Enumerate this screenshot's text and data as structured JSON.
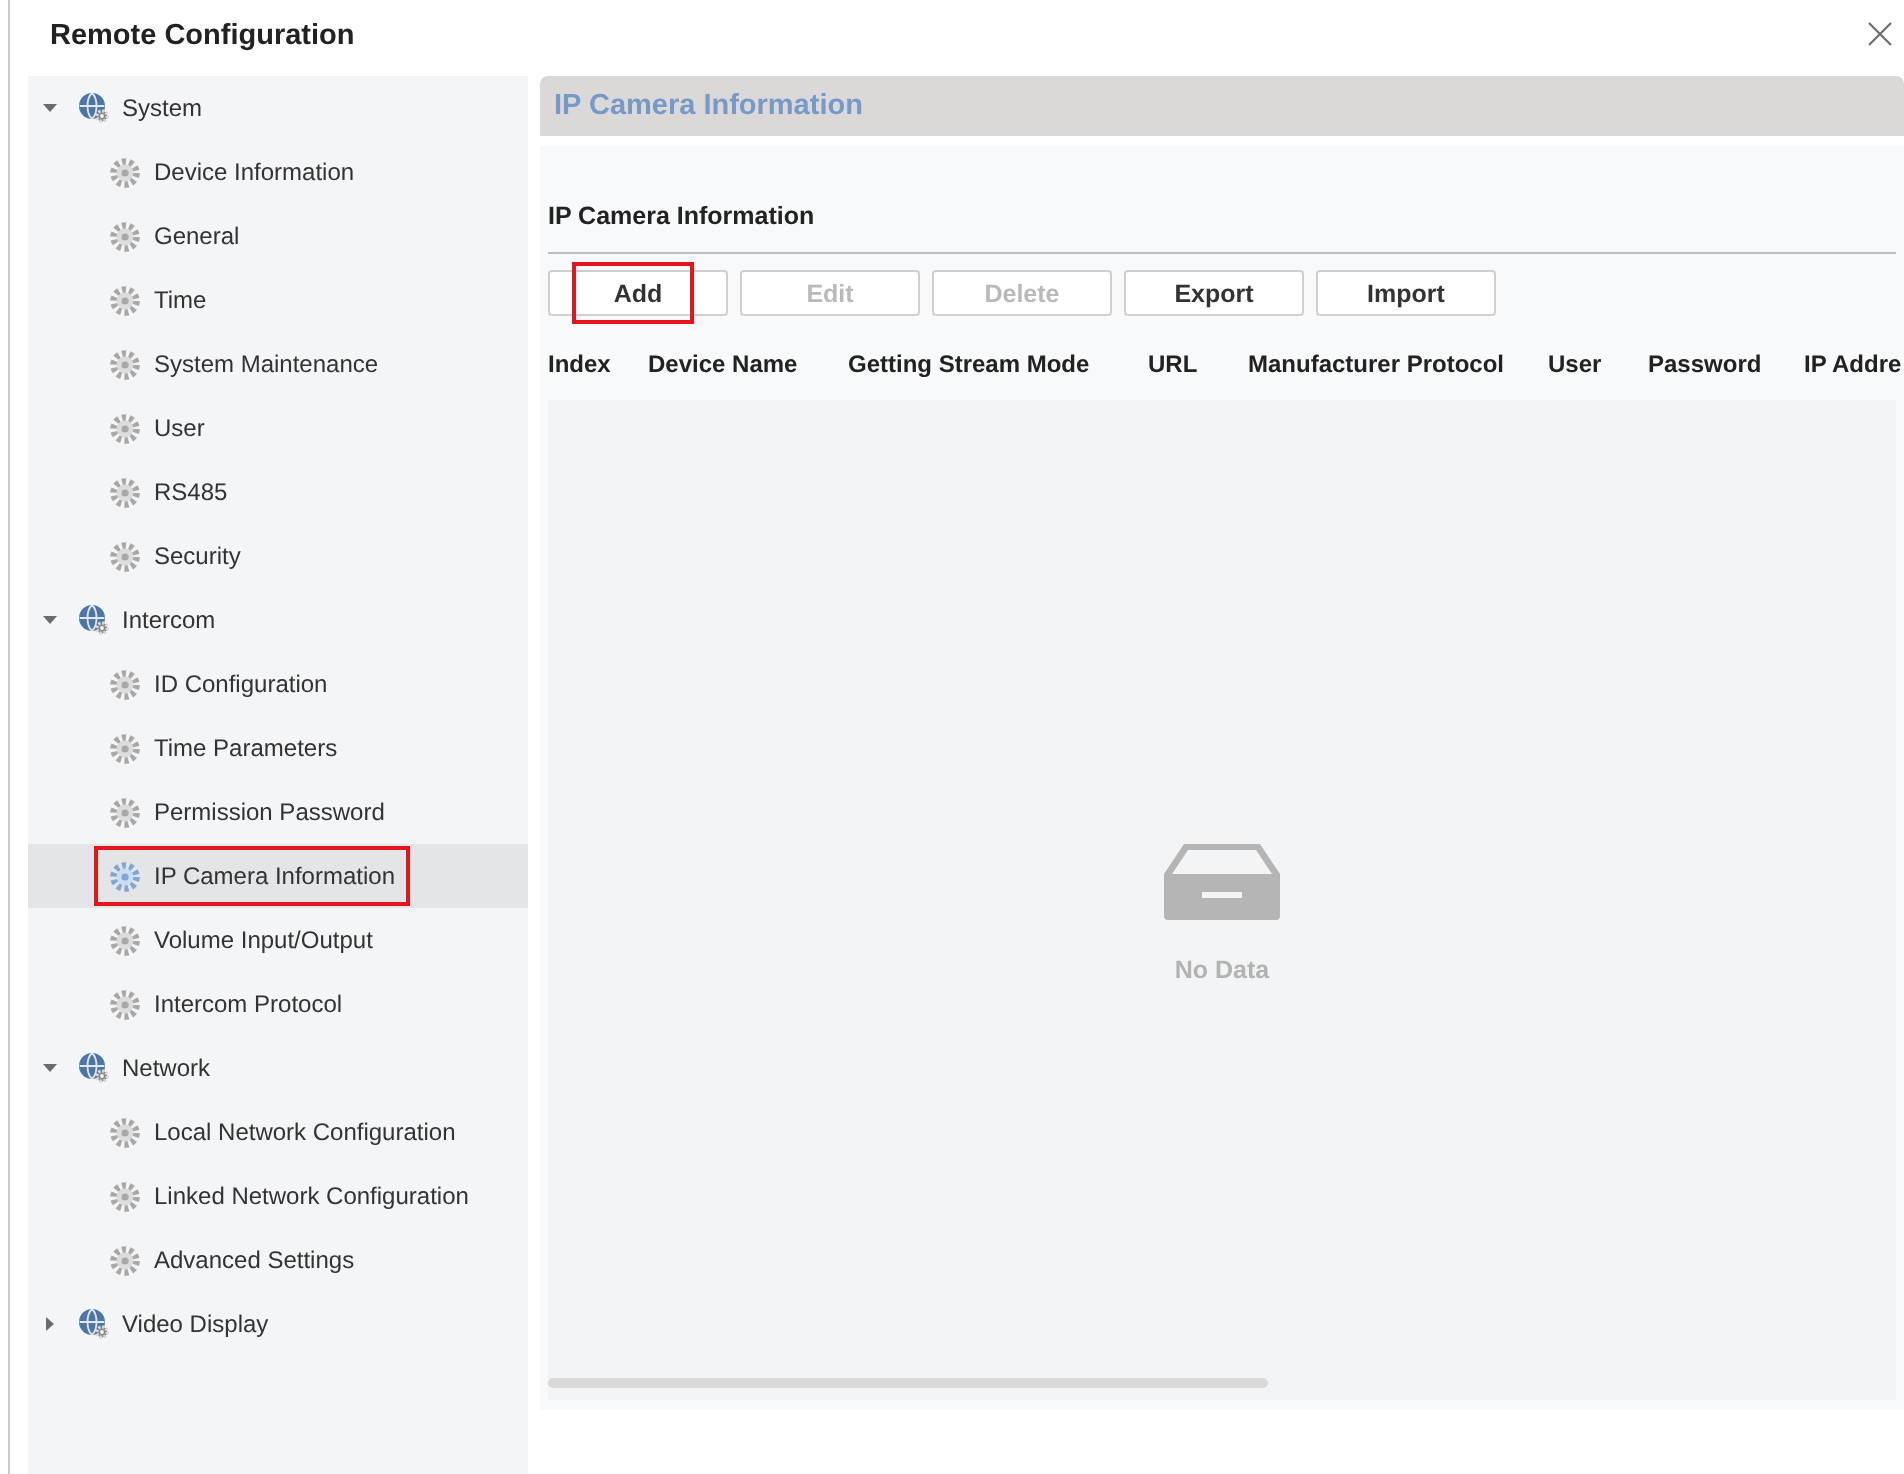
{
  "window": {
    "title": "Remote Configuration"
  },
  "sidebar": {
    "items": [
      {
        "kind": "category",
        "label": "System",
        "expanded": true,
        "selected": false,
        "highlighted": false,
        "children": [
          {
            "kind": "page",
            "label": "Device Information",
            "selected": false,
            "highlighted": false
          },
          {
            "kind": "page",
            "label": "General",
            "selected": false,
            "highlighted": false
          },
          {
            "kind": "page",
            "label": "Time",
            "selected": false,
            "highlighted": false
          },
          {
            "kind": "page",
            "label": "System Maintenance",
            "selected": false,
            "highlighted": false
          },
          {
            "kind": "page",
            "label": "User",
            "selected": false,
            "highlighted": false
          },
          {
            "kind": "page",
            "label": "RS485",
            "selected": false,
            "highlighted": false
          },
          {
            "kind": "page",
            "label": "Security",
            "selected": false,
            "highlighted": false
          }
        ]
      },
      {
        "kind": "category",
        "label": "Intercom",
        "expanded": true,
        "selected": false,
        "highlighted": false,
        "children": [
          {
            "kind": "page",
            "label": "ID Configuration",
            "selected": false,
            "highlighted": false
          },
          {
            "kind": "page",
            "label": "Time Parameters",
            "selected": false,
            "highlighted": false
          },
          {
            "kind": "page",
            "label": "Permission Password",
            "selected": false,
            "highlighted": false
          },
          {
            "kind": "page",
            "label": "IP Camera Information",
            "selected": true,
            "highlighted": true
          },
          {
            "kind": "page",
            "label": "Volume Input/Output",
            "selected": false,
            "highlighted": false
          },
          {
            "kind": "page",
            "label": "Intercom Protocol",
            "selected": false,
            "highlighted": false
          }
        ]
      },
      {
        "kind": "category",
        "label": "Network",
        "expanded": true,
        "selected": false,
        "highlighted": false,
        "children": [
          {
            "kind": "page",
            "label": "Local Network Configuration",
            "selected": false,
            "highlighted": false
          },
          {
            "kind": "page",
            "label": "Linked Network Configuration",
            "selected": false,
            "highlighted": false
          },
          {
            "kind": "page",
            "label": "Advanced Settings",
            "selected": false,
            "highlighted": false
          }
        ]
      },
      {
        "kind": "category",
        "label": "Video Display",
        "expanded": false,
        "selected": false,
        "highlighted": false
      }
    ]
  },
  "panel": {
    "header": "IP Camera Information",
    "section_title": "IP Camera Information",
    "buttons": [
      {
        "label": "Add",
        "disabled": false,
        "highlighted": true
      },
      {
        "label": "Edit",
        "disabled": true,
        "highlighted": false
      },
      {
        "label": "Delete",
        "disabled": true,
        "highlighted": false
      },
      {
        "label": "Export",
        "disabled": false,
        "highlighted": false
      },
      {
        "label": "Import",
        "disabled": false,
        "highlighted": false
      }
    ],
    "table": {
      "columns": [
        "Index",
        "Device Name",
        "Getting Stream Mode",
        "URL",
        "Manufacturer Protocol",
        "User",
        "Password",
        "IP Addre"
      ],
      "empty_text": "No Data"
    }
  }
}
